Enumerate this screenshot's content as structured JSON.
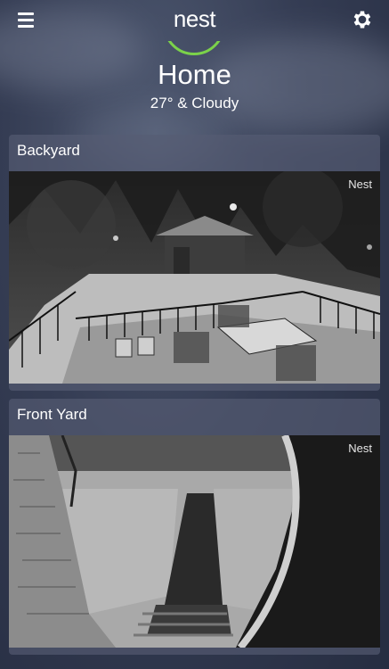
{
  "header": {
    "brand": "nest",
    "menu_icon": "hamburger-menu-icon",
    "settings_icon": "gear-icon"
  },
  "home": {
    "title": "Home",
    "weather": "27° & Cloudy",
    "status_color": "#7bd24a"
  },
  "cameras": [
    {
      "name": "Backyard",
      "badge": "Nest"
    },
    {
      "name": "Front Yard",
      "badge": "Nest"
    }
  ]
}
